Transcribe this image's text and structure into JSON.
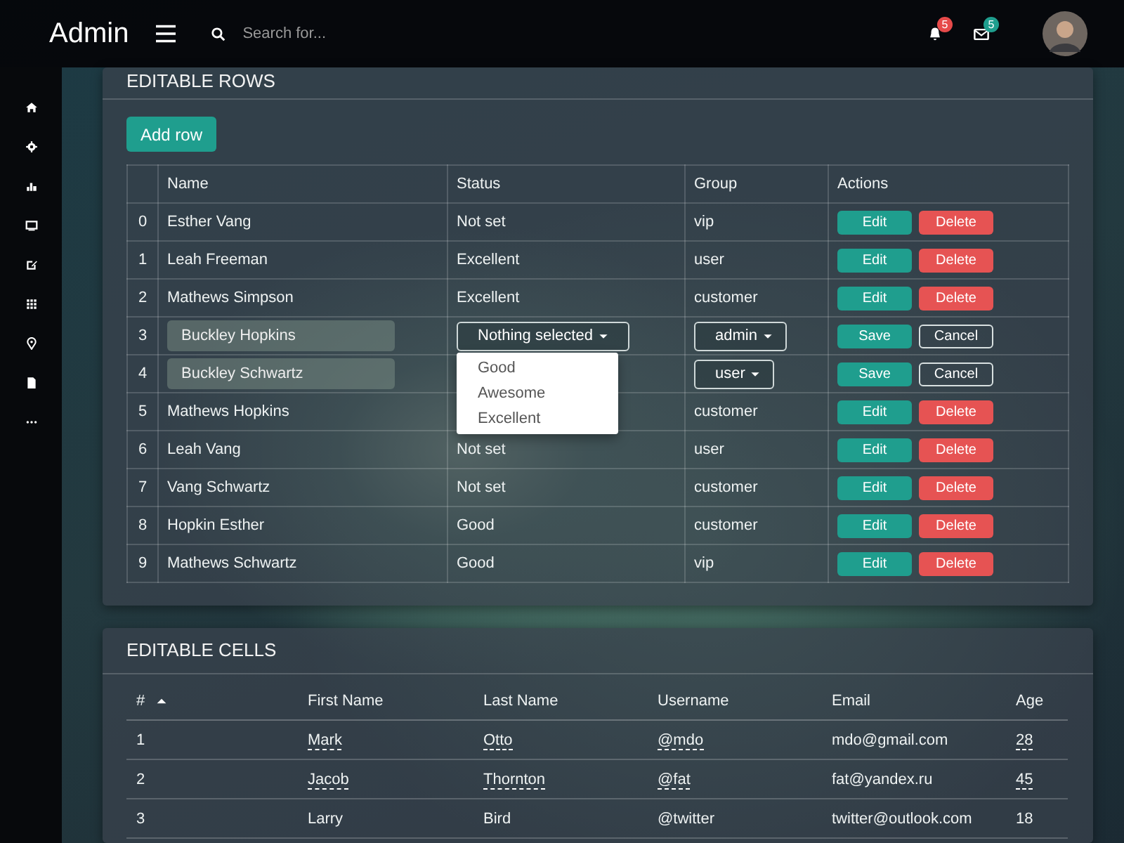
{
  "header": {
    "brand": "Admin",
    "search": {
      "placeholder": "Search for..."
    },
    "notifications": {
      "count": "5"
    },
    "messages": {
      "count": "5"
    }
  },
  "editable_rows": {
    "title": "EDITABLE ROWS",
    "add_button": "Add row",
    "columns": [
      "Name",
      "Status",
      "Group",
      "Actions"
    ],
    "rows": [
      {
        "kind": "view",
        "index": "0",
        "name": "Esther Vang",
        "status": "Not set",
        "group": "vip",
        "actions": [
          "Edit",
          "Delete"
        ]
      },
      {
        "kind": "view",
        "index": "1",
        "name": "Leah Freeman",
        "status": "Excellent",
        "group": "user",
        "actions": [
          "Edit",
          "Delete"
        ]
      },
      {
        "kind": "view",
        "index": "2",
        "name": "Mathews Simpson",
        "status": "Excellent",
        "group": "customer",
        "actions": [
          "Edit",
          "Delete"
        ]
      },
      {
        "kind": "edit",
        "index": "3",
        "name": "Buckley Hopkins",
        "status": "Nothing selected",
        "group": "admin",
        "actions": [
          "Save",
          "Cancel"
        ],
        "menu": [
          "Good",
          "Awesome",
          "Excellent"
        ]
      },
      {
        "kind": "edit",
        "index": "4",
        "name": "Buckley Schwartz",
        "group": "user",
        "actions": [
          "Save",
          "Cancel"
        ]
      },
      {
        "kind": "view",
        "index": "5",
        "name": "Mathews Hopkins",
        "group": "customer",
        "actions": [
          "Edit",
          "Delete"
        ]
      },
      {
        "kind": "view",
        "index": "6",
        "name": "Leah Vang",
        "status": "Not set",
        "group": "user",
        "actions": [
          "Edit",
          "Delete"
        ]
      },
      {
        "kind": "view",
        "index": "7",
        "name": "Vang Schwartz",
        "status": "Not set",
        "group": "customer",
        "actions": [
          "Edit",
          "Delete"
        ]
      },
      {
        "kind": "view",
        "index": "8",
        "name": "Hopkin Esther",
        "status": "Good",
        "group": "customer",
        "actions": [
          "Edit",
          "Delete"
        ]
      },
      {
        "kind": "view",
        "index": "9",
        "name": "Mathews Schwartz",
        "status": "Good",
        "group": "vip",
        "actions": [
          "Edit",
          "Delete"
        ]
      }
    ]
  },
  "editable_cells": {
    "title": "EDITABLE CELLS",
    "columns": [
      {
        "label": "#",
        "sorted": true
      },
      {
        "label": "First Name",
        "sorted": false
      },
      {
        "label": "Last Name",
        "sorted": false
      },
      {
        "label": "Username",
        "sorted": false
      },
      {
        "label": "Email",
        "sorted": false
      },
      {
        "label": "Age",
        "sorted": false
      }
    ],
    "rows": [
      [
        {
          "text": "1",
          "editable": false
        },
        {
          "text": "Mark",
          "editable": true
        },
        {
          "text": "Otto",
          "editable": true
        },
        {
          "text": "@mdo",
          "editable": true
        },
        {
          "text": "mdo@gmail.com",
          "editable": false
        },
        {
          "text": "28",
          "editable": true
        }
      ],
      [
        {
          "text": "2",
          "editable": false
        },
        {
          "text": "Jacob",
          "editable": true
        },
        {
          "text": "Thornton",
          "editable": true
        },
        {
          "text": "@fat",
          "editable": true
        },
        {
          "text": "fat@yandex.ru",
          "editable": false
        },
        {
          "text": "45",
          "editable": true
        }
      ],
      [
        {
          "text": "3",
          "editable": false
        },
        {
          "text": "Larry",
          "editable": false
        },
        {
          "text": "Bird",
          "editable": false
        },
        {
          "text": "@twitter",
          "editable": false
        },
        {
          "text": "twitter@outlook.com",
          "editable": false
        },
        {
          "text": "18",
          "editable": false
        }
      ]
    ]
  }
}
